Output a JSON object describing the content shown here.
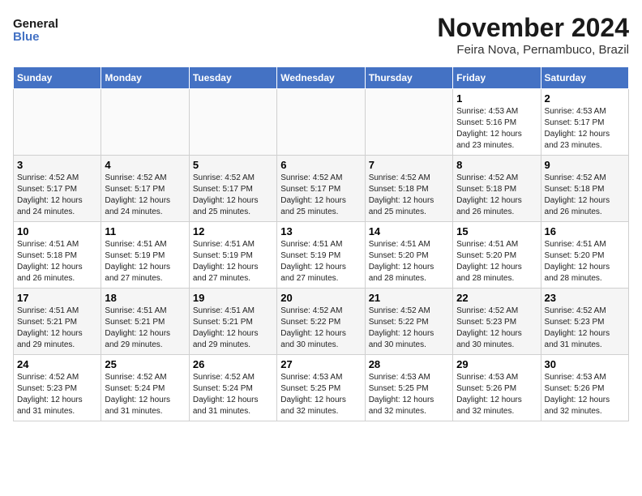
{
  "logo": {
    "line1": "General",
    "line2": "Blue"
  },
  "title": "November 2024",
  "subtitle": "Feira Nova, Pernambuco, Brazil",
  "weekdays": [
    "Sunday",
    "Monday",
    "Tuesday",
    "Wednesday",
    "Thursday",
    "Friday",
    "Saturday"
  ],
  "weeks": [
    [
      {
        "day": "",
        "info": ""
      },
      {
        "day": "",
        "info": ""
      },
      {
        "day": "",
        "info": ""
      },
      {
        "day": "",
        "info": ""
      },
      {
        "day": "",
        "info": ""
      },
      {
        "day": "1",
        "info": "Sunrise: 4:53 AM\nSunset: 5:16 PM\nDaylight: 12 hours and 23 minutes."
      },
      {
        "day": "2",
        "info": "Sunrise: 4:53 AM\nSunset: 5:17 PM\nDaylight: 12 hours and 23 minutes."
      }
    ],
    [
      {
        "day": "3",
        "info": "Sunrise: 4:52 AM\nSunset: 5:17 PM\nDaylight: 12 hours and 24 minutes."
      },
      {
        "day": "4",
        "info": "Sunrise: 4:52 AM\nSunset: 5:17 PM\nDaylight: 12 hours and 24 minutes."
      },
      {
        "day": "5",
        "info": "Sunrise: 4:52 AM\nSunset: 5:17 PM\nDaylight: 12 hours and 25 minutes."
      },
      {
        "day": "6",
        "info": "Sunrise: 4:52 AM\nSunset: 5:17 PM\nDaylight: 12 hours and 25 minutes."
      },
      {
        "day": "7",
        "info": "Sunrise: 4:52 AM\nSunset: 5:18 PM\nDaylight: 12 hours and 25 minutes."
      },
      {
        "day": "8",
        "info": "Sunrise: 4:52 AM\nSunset: 5:18 PM\nDaylight: 12 hours and 26 minutes."
      },
      {
        "day": "9",
        "info": "Sunrise: 4:52 AM\nSunset: 5:18 PM\nDaylight: 12 hours and 26 minutes."
      }
    ],
    [
      {
        "day": "10",
        "info": "Sunrise: 4:51 AM\nSunset: 5:18 PM\nDaylight: 12 hours and 26 minutes."
      },
      {
        "day": "11",
        "info": "Sunrise: 4:51 AM\nSunset: 5:19 PM\nDaylight: 12 hours and 27 minutes."
      },
      {
        "day": "12",
        "info": "Sunrise: 4:51 AM\nSunset: 5:19 PM\nDaylight: 12 hours and 27 minutes."
      },
      {
        "day": "13",
        "info": "Sunrise: 4:51 AM\nSunset: 5:19 PM\nDaylight: 12 hours and 27 minutes."
      },
      {
        "day": "14",
        "info": "Sunrise: 4:51 AM\nSunset: 5:20 PM\nDaylight: 12 hours and 28 minutes."
      },
      {
        "day": "15",
        "info": "Sunrise: 4:51 AM\nSunset: 5:20 PM\nDaylight: 12 hours and 28 minutes."
      },
      {
        "day": "16",
        "info": "Sunrise: 4:51 AM\nSunset: 5:20 PM\nDaylight: 12 hours and 28 minutes."
      }
    ],
    [
      {
        "day": "17",
        "info": "Sunrise: 4:51 AM\nSunset: 5:21 PM\nDaylight: 12 hours and 29 minutes."
      },
      {
        "day": "18",
        "info": "Sunrise: 4:51 AM\nSunset: 5:21 PM\nDaylight: 12 hours and 29 minutes."
      },
      {
        "day": "19",
        "info": "Sunrise: 4:51 AM\nSunset: 5:21 PM\nDaylight: 12 hours and 29 minutes."
      },
      {
        "day": "20",
        "info": "Sunrise: 4:52 AM\nSunset: 5:22 PM\nDaylight: 12 hours and 30 minutes."
      },
      {
        "day": "21",
        "info": "Sunrise: 4:52 AM\nSunset: 5:22 PM\nDaylight: 12 hours and 30 minutes."
      },
      {
        "day": "22",
        "info": "Sunrise: 4:52 AM\nSunset: 5:23 PM\nDaylight: 12 hours and 30 minutes."
      },
      {
        "day": "23",
        "info": "Sunrise: 4:52 AM\nSunset: 5:23 PM\nDaylight: 12 hours and 31 minutes."
      }
    ],
    [
      {
        "day": "24",
        "info": "Sunrise: 4:52 AM\nSunset: 5:23 PM\nDaylight: 12 hours and 31 minutes."
      },
      {
        "day": "25",
        "info": "Sunrise: 4:52 AM\nSunset: 5:24 PM\nDaylight: 12 hours and 31 minutes."
      },
      {
        "day": "26",
        "info": "Sunrise: 4:52 AM\nSunset: 5:24 PM\nDaylight: 12 hours and 31 minutes."
      },
      {
        "day": "27",
        "info": "Sunrise: 4:53 AM\nSunset: 5:25 PM\nDaylight: 12 hours and 32 minutes."
      },
      {
        "day": "28",
        "info": "Sunrise: 4:53 AM\nSunset: 5:25 PM\nDaylight: 12 hours and 32 minutes."
      },
      {
        "day": "29",
        "info": "Sunrise: 4:53 AM\nSunset: 5:26 PM\nDaylight: 12 hours and 32 minutes."
      },
      {
        "day": "30",
        "info": "Sunrise: 4:53 AM\nSunset: 5:26 PM\nDaylight: 12 hours and 32 minutes."
      }
    ]
  ]
}
